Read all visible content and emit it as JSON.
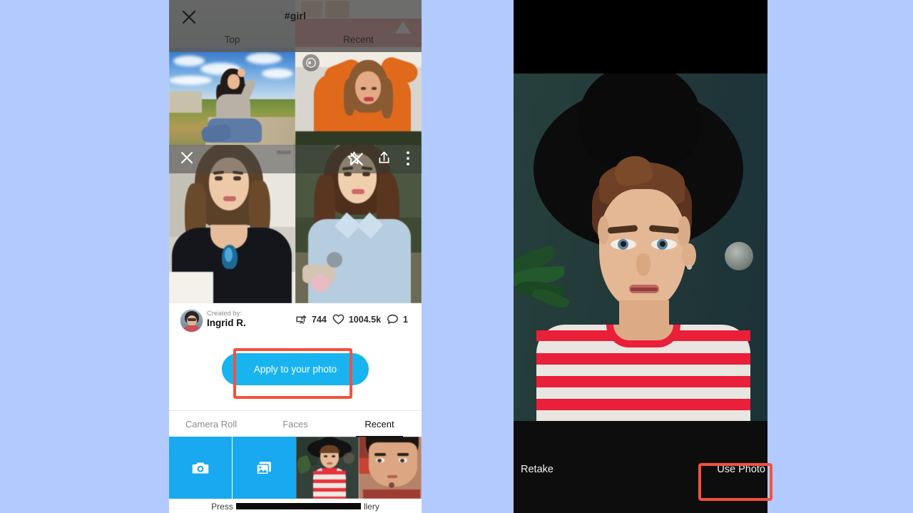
{
  "background_color": "#b3caff",
  "left_phone": {
    "header": {
      "close_icon": "close-icon",
      "title": "#girl",
      "tabs": [
        {
          "label": "Top",
          "active": false
        },
        {
          "label": "Recent",
          "active": false
        }
      ]
    },
    "detail_overlay": {
      "close_icon": "close-icon",
      "star_icon": "star-icon",
      "share_icon": "share-icon",
      "more_icon": "more-vertical-icon"
    },
    "creator": {
      "label": "Created by:",
      "name": "Ingrid R.",
      "avatar": "user-avatar"
    },
    "stats": [
      {
        "icon": "remix-icon",
        "value": "744"
      },
      {
        "icon": "heart-icon",
        "value": "1004.5k"
      },
      {
        "icon": "comment-icon",
        "value": "1"
      }
    ],
    "apply_button": {
      "label": "Apply to your photo",
      "color": "#18b4f0",
      "highlight_color": "#f4513c"
    },
    "bottom_tabs": [
      {
        "label": "Camera Roll",
        "active": false
      },
      {
        "label": "Faces",
        "active": false
      },
      {
        "label": "Recent",
        "active": true
      }
    ],
    "picker_strip": [
      {
        "type": "camera",
        "icon": "camera-icon",
        "color": "#18a9f0"
      },
      {
        "type": "gallery",
        "icon": "gallery-icon",
        "color": "#18a9f0"
      },
      {
        "type": "photo",
        "icon": "photo-thumbnail-hat-man"
      },
      {
        "type": "photo",
        "icon": "photo-thumbnail-man"
      }
    ],
    "bottom_caption": {
      "prefix": "Press",
      "redacted": true,
      "suffix": "llery"
    }
  },
  "right_phone": {
    "preview": "camera-photo-preview",
    "retake_label": "Retake",
    "use_photo_label": "Use Photo",
    "highlight_color": "#f4513c"
  }
}
